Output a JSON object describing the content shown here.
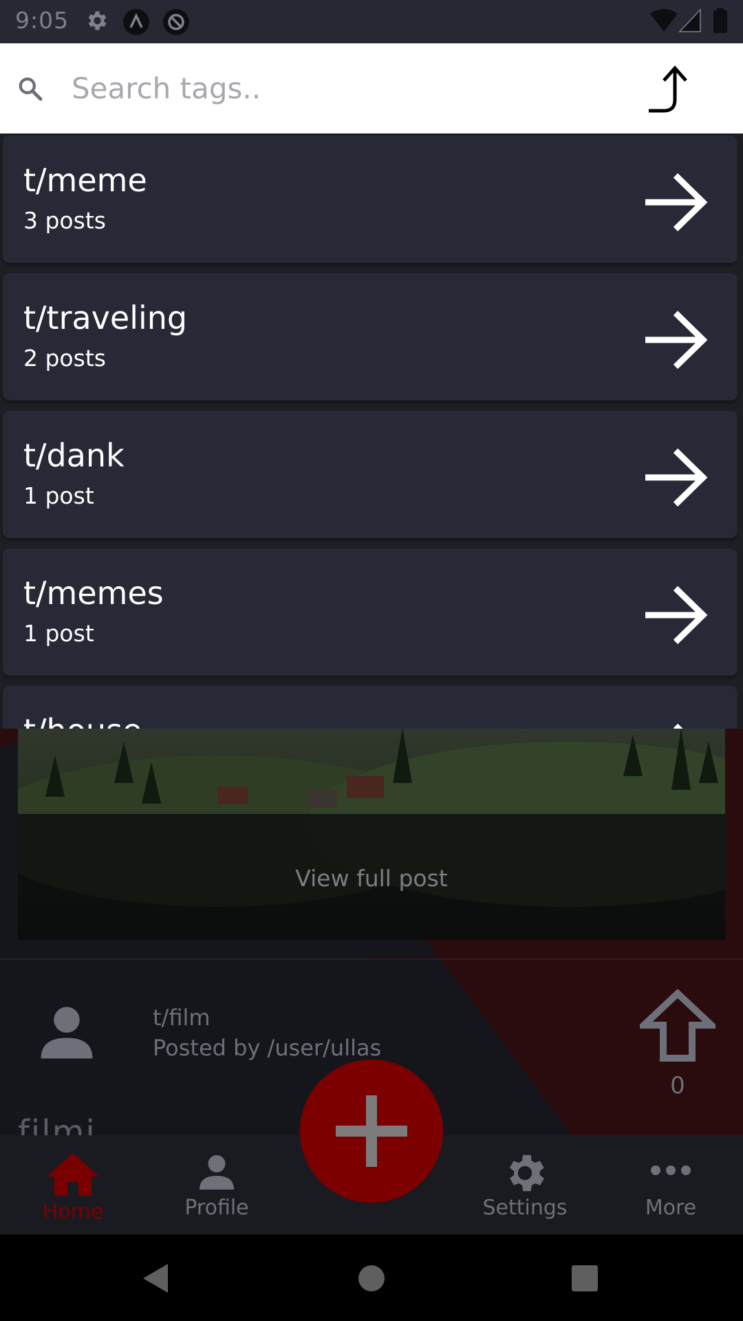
{
  "status_bar": {
    "time": "9:05",
    "icons_left": [
      "gear-icon",
      "notification-a-icon",
      "notification-at-icon"
    ],
    "icons_right": [
      "wifi-icon",
      "signal-icon",
      "battery-icon"
    ]
  },
  "search": {
    "placeholder": "Search tags..",
    "value": ""
  },
  "tags": [
    {
      "name": "t/meme",
      "count": "3 posts"
    },
    {
      "name": "t/traveling",
      "count": "2 posts"
    },
    {
      "name": "t/dank",
      "count": "1 post"
    },
    {
      "name": "t/memes",
      "count": "1 post"
    },
    {
      "name": "t/house",
      "count": ""
    }
  ],
  "feed": {
    "view_full_post": "View full post",
    "post": {
      "tag": "t/film",
      "posted_by": "Posted by /user/ullas",
      "votes": "0",
      "title": "filmi"
    }
  },
  "bottom_nav": {
    "items": [
      {
        "label": "Home",
        "icon": "home-icon",
        "active": true
      },
      {
        "label": "Profile",
        "icon": "person-icon",
        "active": false
      },
      {
        "label": "Settings",
        "icon": "gear-icon",
        "active": false
      },
      {
        "label": "More",
        "icon": "more-dots-icon",
        "active": false
      }
    ],
    "fab_icon": "plus-icon"
  },
  "colors": {
    "accent": "#7d0000",
    "card": "#272a36",
    "search_bg": "#ffffff",
    "status_bar": "#262833"
  }
}
